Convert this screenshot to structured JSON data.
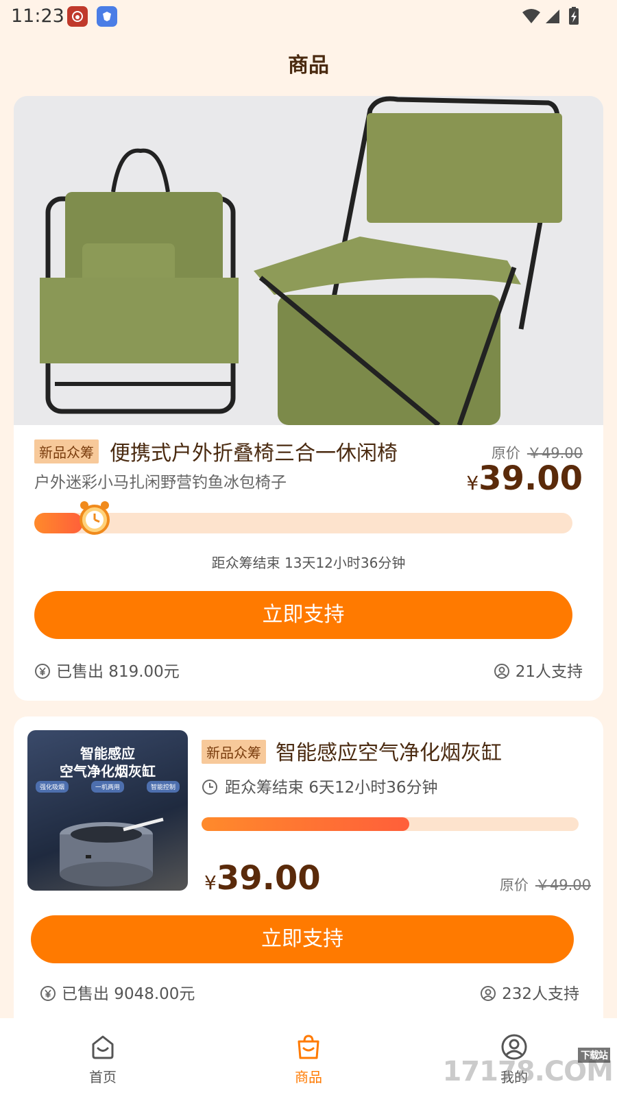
{
  "status_bar": {
    "time": "11:23"
  },
  "header": {
    "title": "商品"
  },
  "products": [
    {
      "badge": "新品众筹",
      "title": "便携式户外折叠椅三合一休闲椅",
      "subtitle": "户外迷彩小马扎闲野营钓鱼冰包椅子",
      "original_label": "原价",
      "original_price": "￥49.00",
      "currency": "¥",
      "price": "39.00",
      "progress": 0.09,
      "deadline": "距众筹结束 13天12小时36分钟",
      "cta": "立即支持",
      "sold": "已售出 819.00元",
      "supporters": "21人支持"
    },
    {
      "badge": "新品众筹",
      "title": "智能感应空气净化烟灰缸",
      "thumb_title_1": "智能感应",
      "thumb_title_2": "空气净化烟灰缸",
      "thumb_tags": [
        "强化吸烟",
        "一机两用",
        "智能控制"
      ],
      "deadline": "距众筹结束 6天12小时36分钟",
      "progress": 0.55,
      "currency": "¥",
      "price": "39.00",
      "original_label": "原价",
      "original_price": "￥49.00",
      "cta": "立即支持",
      "sold": "已售出 9048.00元",
      "supporters": "232人支持"
    }
  ],
  "bottom_nav": [
    {
      "label": "首页",
      "icon": "home-icon",
      "active": false
    },
    {
      "label": "商品",
      "icon": "shopping-bag-icon",
      "active": true
    },
    {
      "label": "我的",
      "icon": "user-icon",
      "active": false
    }
  ],
  "watermark": {
    "text": "17178.COM",
    "tag": "下载站"
  },
  "colors": {
    "accent": "#ff7a00",
    "background": "#fff3e8",
    "price": "#5a2a0a",
    "badge": "#f7c99a"
  }
}
